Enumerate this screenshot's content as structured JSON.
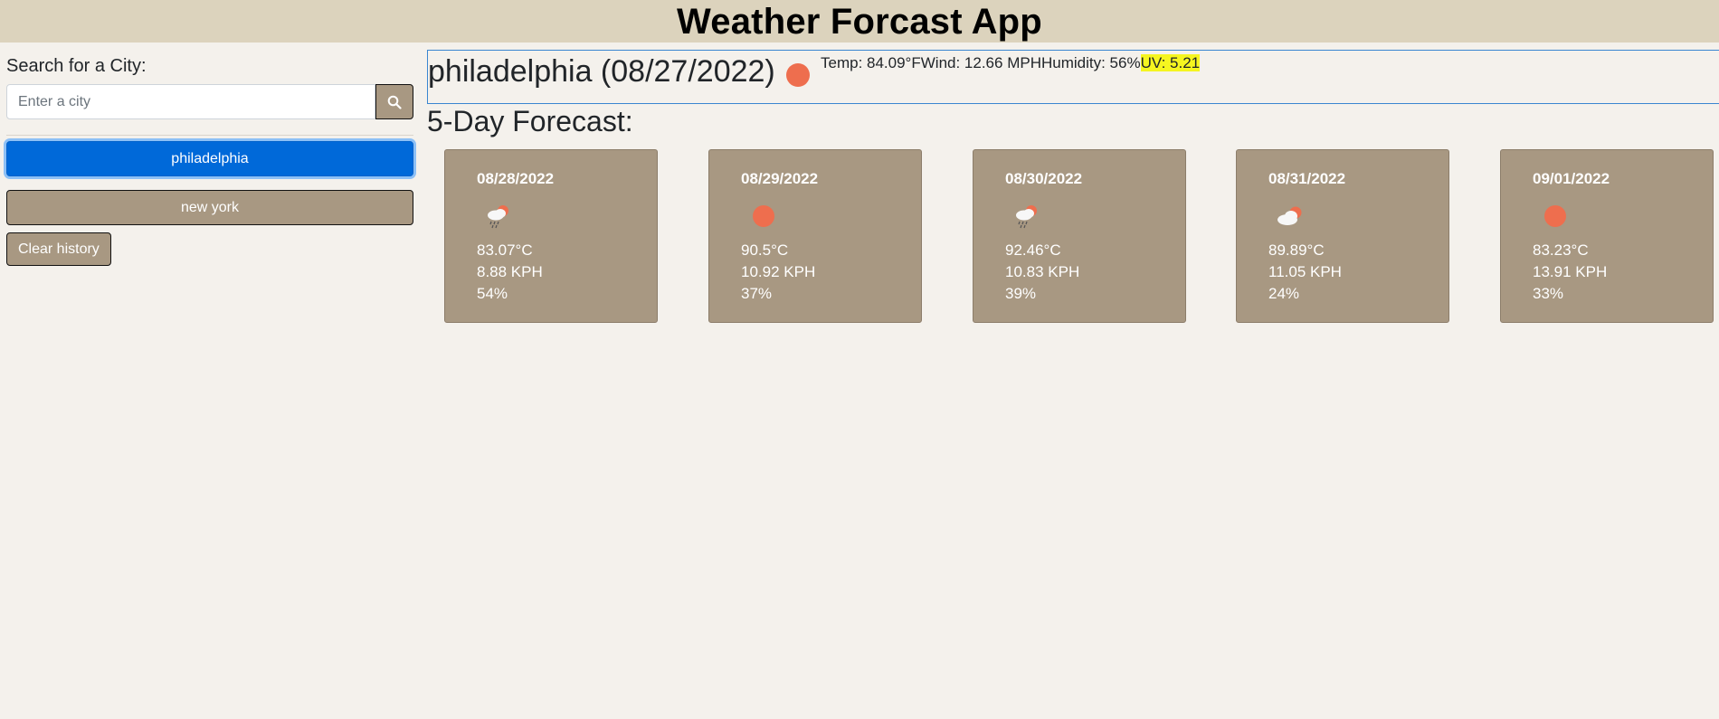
{
  "header": {
    "title": "Weather Forcast App"
  },
  "sidebar": {
    "search_label": "Search for a City:",
    "search_placeholder": "Enter a city",
    "search_value": "",
    "search_icon": "search-icon",
    "history": [
      {
        "label": "philadelphia",
        "active": true
      },
      {
        "label": "new york",
        "active": false
      }
    ],
    "clear_label": "Clear history"
  },
  "current": {
    "title": "philadelphia (08/27/2022)",
    "icon": "sun-icon",
    "temp": "Temp: 84.09°F",
    "wind": "Wind: 12.66 MPH",
    "humidity": "Humidity: 56%",
    "uv": "UV: 5.21",
    "uv_color": "#f5f520"
  },
  "forecast": {
    "title": "5-Day Forecast:",
    "days": [
      {
        "date": "08/28/2022",
        "icon": "rain-cloud-sun-icon",
        "temp": "83.07°C",
        "wind": "8.88 KPH",
        "humidity": "54%"
      },
      {
        "date": "08/29/2022",
        "icon": "sun-icon",
        "temp": "90.5°C",
        "wind": "10.92 KPH",
        "humidity": "37%"
      },
      {
        "date": "08/30/2022",
        "icon": "rain-cloud-sun-icon",
        "temp": "92.46°C",
        "wind": "10.83 KPH",
        "humidity": "39%"
      },
      {
        "date": "08/31/2022",
        "icon": "cloud-sun-icon",
        "temp": "89.89°C",
        "wind": "11.05 KPH",
        "humidity": "24%"
      },
      {
        "date": "09/01/2022",
        "icon": "sun-icon",
        "temp": "83.23°C",
        "wind": "13.91 KPH",
        "humidity": "33%"
      }
    ]
  },
  "colors": {
    "header_bg": "#dcd3bd",
    "page_bg": "#f4f1ec",
    "card_bg": "#a89882",
    "active_button": "#0069d9",
    "sun": "#ee6e4e"
  }
}
